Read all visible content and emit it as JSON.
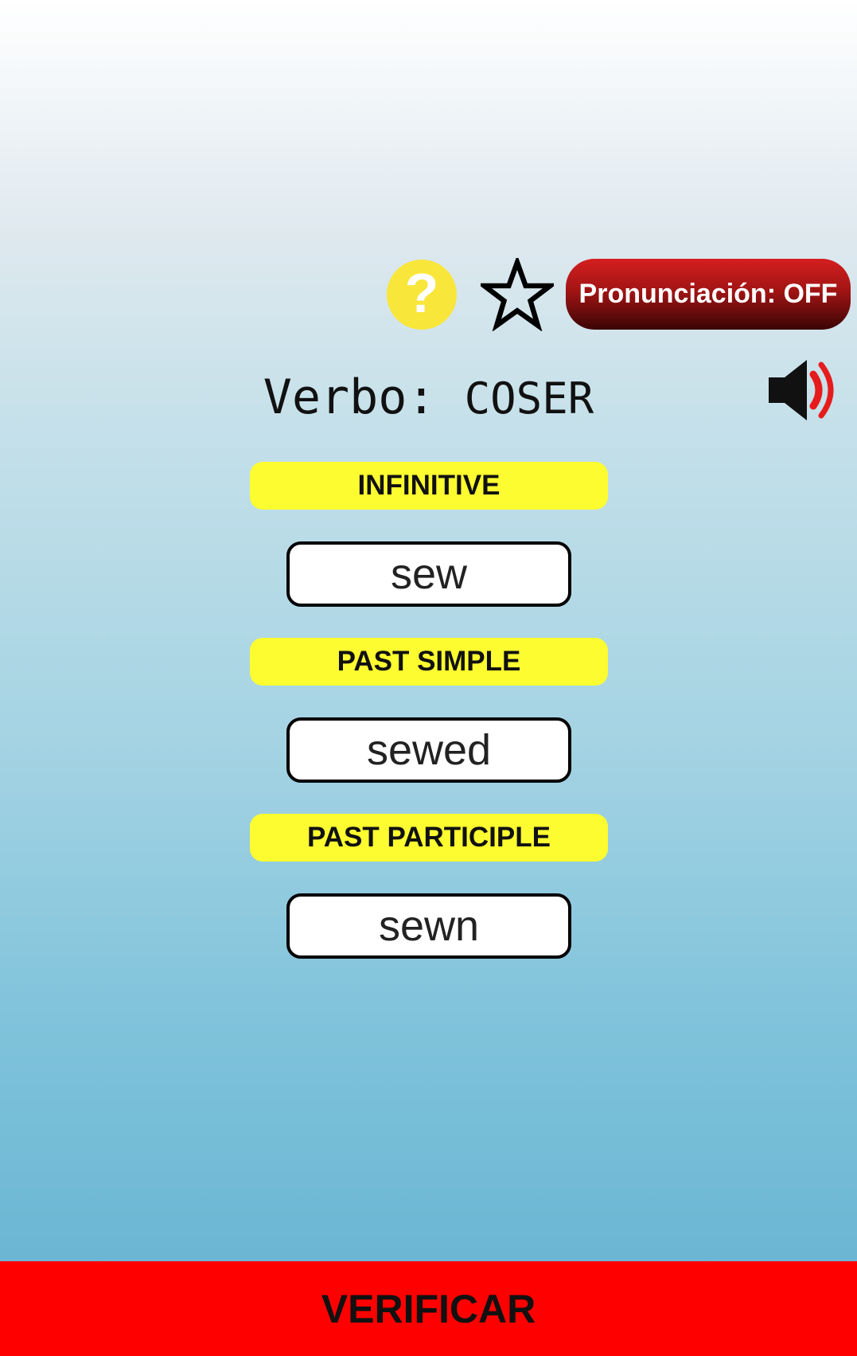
{
  "header": {
    "help_symbol": "?",
    "help_icon": "question-mark-circle-icon",
    "favorite_icon": "star-outline-icon",
    "pronunciation_label": "Pronunciación: OFF",
    "speaker_icon": "speaker-volume-icon"
  },
  "verb": {
    "prefix": "Verbo:",
    "value": "COSER"
  },
  "forms": [
    {
      "label": "INFINITIVE",
      "answer": "sew"
    },
    {
      "label": "PAST SIMPLE",
      "answer": "sewed"
    },
    {
      "label": "PAST PARTICIPLE",
      "answer": "sewn"
    }
  ],
  "footer": {
    "verify_label": "VERIFICAR"
  },
  "colors": {
    "label_background": "#fcfc30",
    "verify_background": "#ff0000",
    "help_background": "#f9e63a",
    "pronunciation_top": "#d51f1f",
    "pronunciation_bottom": "#3b0505",
    "speaker_wave": "#e61c1c"
  }
}
